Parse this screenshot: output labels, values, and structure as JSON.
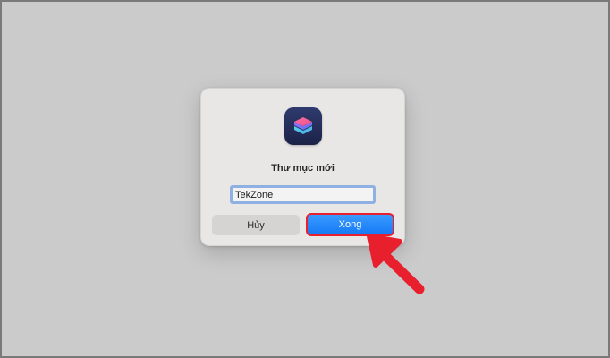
{
  "dialog": {
    "app_icon": "shortcuts-app-icon",
    "title": "Thư mục mới",
    "folder_name_value": "TekZone",
    "cancel_label": "Hủy",
    "done_label": "Xong"
  },
  "annotation": {
    "arrow_icon": "pointer-arrow-icon",
    "highlight_color": "#e8202e"
  },
  "colors": {
    "background": "#cbcbcb",
    "dialog": "#e9e6e6",
    "accent": "#1579f5"
  }
}
